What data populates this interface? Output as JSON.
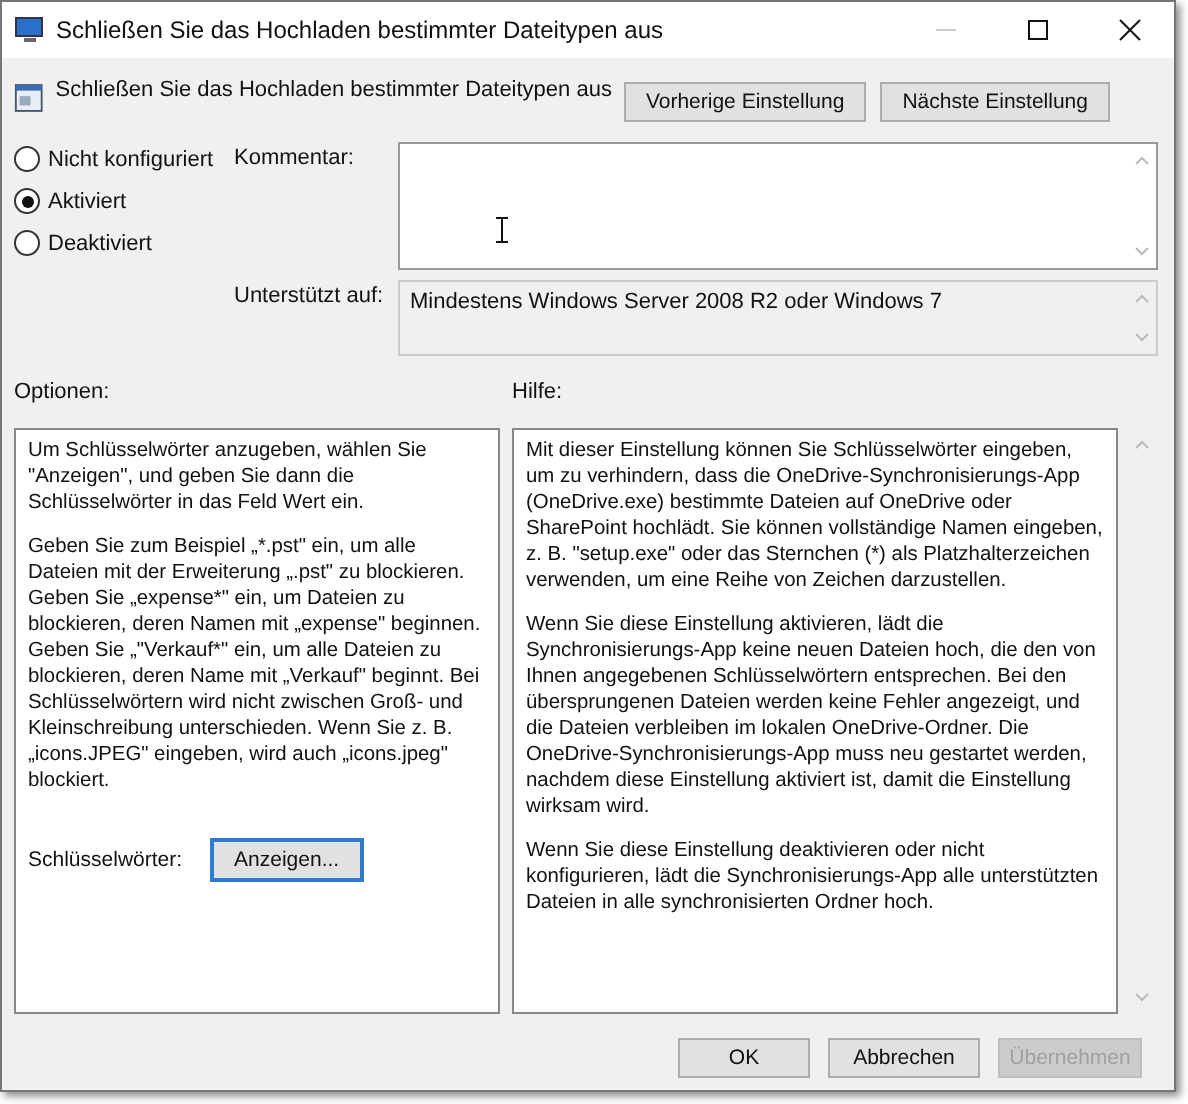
{
  "window": {
    "title": "Schließen Sie das Hochladen bestimmter Dateitypen aus"
  },
  "header": {
    "title": "Schließen Sie das Hochladen bestimmter Dateitypen aus",
    "buttons": [
      "Vorherige Einstellung",
      "Nächste Einstellung"
    ]
  },
  "states": [
    {
      "label": "Nicht konfiguriert",
      "selected": false
    },
    {
      "label": "Aktiviert",
      "selected": true
    },
    {
      "label": "Deaktiviert",
      "selected": false
    }
  ],
  "comment": {
    "label": "Kommentar:"
  },
  "supported": {
    "label": "Unterstützt auf:",
    "value": "Mindestens Windows Server 2008 R2 oder Windows 7"
  },
  "options": {
    "label": "Optionen:",
    "paragraphs": [
      "Um Schlüsselwörter anzugeben, wählen Sie \"Anzeigen\", und geben Sie dann die Schlüsselwörter in das Feld Wert ein.",
      "Geben Sie zum Beispiel „*.pst\" ein, um alle Dateien mit der Erweiterung „.pst\" zu blockieren. Geben Sie „expense*\" ein, um Dateien zu blockieren, deren Namen mit „expense\" beginnen. Geben Sie „\"Verkauf*\" ein, um alle Dateien zu blockieren, deren Name mit „Verkauf\" beginnt. Bei Schlüsselwörtern wird nicht zwischen Groß- und Kleinschreibung unterschieden. Wenn Sie z. B. „icons.JPEG\" eingeben, wird auch „icons.jpeg\" blockiert."
    ],
    "keywords_label": "Schlüsselwörter:",
    "show_button": "Anzeigen..."
  },
  "help": {
    "label": "Hilfe:",
    "paragraphs": [
      "Mit dieser Einstellung können Sie Schlüsselwörter eingeben, um zu verhindern, dass die OneDrive-Synchronisierungs-App (OneDrive.exe) bestimmte Dateien auf OneDrive oder SharePoint hochlädt. Sie können vollständige Namen eingeben, z. B. \"setup.exe\" oder das Sternchen (*) als Platzhalterzeichen verwenden, um eine Reihe von Zeichen darzustellen.",
      "Wenn Sie diese Einstellung aktivieren, lädt die Synchronisierungs-App keine neuen Dateien hoch, die den von Ihnen angegebenen Schlüsselwörtern entsprechen. Bei den übersprungenen Dateien werden keine Fehler angezeigt, und die Dateien verbleiben im lokalen OneDrive-Ordner. Die OneDrive-Synchronisierungs-App muss neu gestartet werden, nachdem diese Einstellung aktiviert ist, damit die Einstellung wirksam wird.",
      "Wenn Sie diese Einstellung deaktivieren oder nicht konfigurieren, lädt die Synchronisierungs-App alle unterstützten Dateien in alle synchronisierten Ordner hoch."
    ]
  },
  "footer": [
    {
      "label": "OK",
      "disabled": false
    },
    {
      "label": "Abbrechen",
      "disabled": false
    },
    {
      "label": "Übernehmen",
      "disabled": true
    }
  ]
}
